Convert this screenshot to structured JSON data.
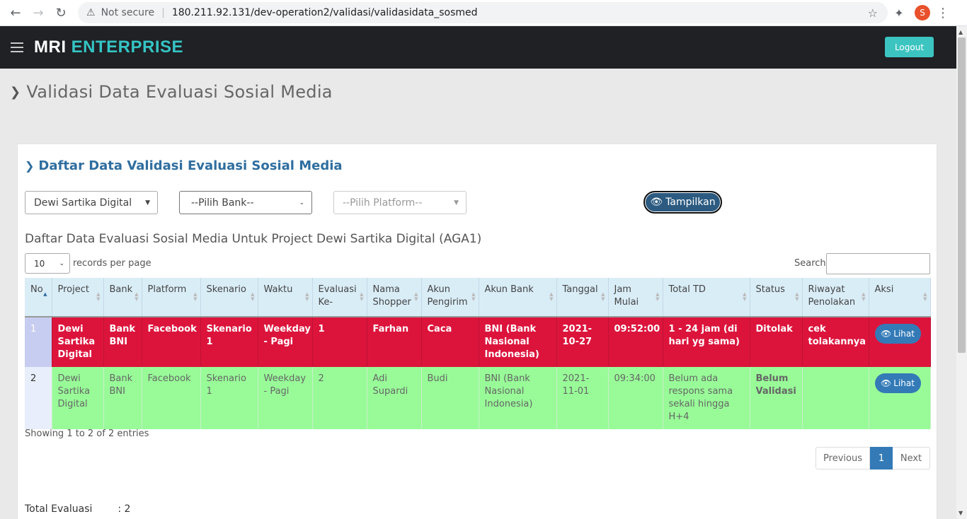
{
  "browser": {
    "security": "Not secure",
    "url": "180.211.92.131/dev-operation2/validasi/validasidata_sosmed",
    "profile_initial": "S"
  },
  "header": {
    "brand_primary": "MRI",
    "brand_secondary": "ENTERPRISE",
    "logout_label": "Logout"
  },
  "page": {
    "title": "Validasi Data Evaluasi Sosial Media"
  },
  "panel": {
    "title": "Daftar Data Validasi Evaluasi Sosial Media",
    "filters": {
      "project": "Dewi Sartika Digital",
      "bank": "--Pilih Bank--",
      "platform": "--Pilih Platform--"
    },
    "show_button": "Tampilkan",
    "table_caption": "Daftar Data Evaluasi Sosial Media Untuk Project Dewi Sartika Digital (AGA1)",
    "length_value": "10",
    "length_label": "records per page",
    "search_label": "Search:",
    "columns": [
      "No",
      "Project",
      "Bank",
      "Platform",
      "Skenario",
      "Waktu",
      "Evaluasi Ke-",
      "Nama Shopper",
      "Akun Pengirim",
      "Akun Bank",
      "Tanggal",
      "Jam Mulai",
      "Total TD",
      "Status",
      "Riwayat Penolakan",
      "Aksi"
    ],
    "rows": [
      {
        "no": "1",
        "project": "Dewi Sartika Digital",
        "bank": "Bank BNI",
        "platform": "Facebook",
        "skenario": "Skenario 1",
        "waktu": "Weekday - Pagi",
        "evaluasi": "1",
        "shopper": "Farhan",
        "pengirim": "Caca",
        "akun_bank": "BNI (Bank Nasional Indonesia)",
        "tanggal": "2021-10-27",
        "jam": "09:52:00",
        "total_td": "1 - 24 jam (di hari yg sama)",
        "status": "Ditolak",
        "riwayat": "cek tolakannya",
        "aksi": "Lihat"
      },
      {
        "no": "2",
        "project": "Dewi Sartika Digital",
        "bank": "Bank BNI",
        "platform": "Facebook",
        "skenario": "Skenario 1",
        "waktu": "Weekday - Pagi",
        "evaluasi": "2",
        "shopper": "Adi Supardi",
        "pengirim": "Budi",
        "akun_bank": "BNI (Bank Nasional Indonesia)",
        "tanggal": "2021-11-01",
        "jam": "09:34:00",
        "total_td": "Belum ada respons sama sekali hingga H+4",
        "status": "Belum Validasi",
        "riwayat": "",
        "aksi": "Lihat"
      }
    ],
    "info": "Showing 1 to 2 of 2 entries",
    "pager": {
      "prev": "Previous",
      "current": "1",
      "next": "Next"
    },
    "total_label": "Total Evaluasi",
    "total_value": ": 2"
  },
  "colors": {
    "row_rejected": "#dc143c",
    "row_pending": "#98fb98",
    "accent": "#337ab7",
    "brand_teal": "#35c4c4"
  }
}
